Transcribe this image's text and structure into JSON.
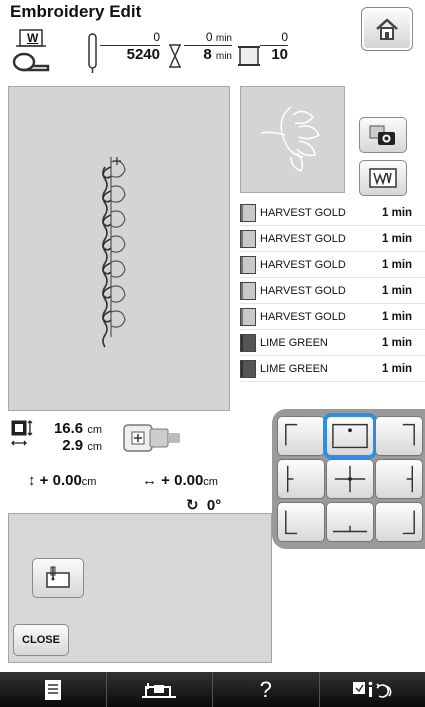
{
  "header": {
    "title": "Embroidery Edit",
    "presser_foot_letter": "W",
    "stitch_count_current": "0",
    "stitch_count_total": "5240",
    "time_current": "0",
    "time_total": "8",
    "time_unit": "min",
    "color_current": "0",
    "color_total": "10"
  },
  "threads": [
    {
      "name": "HARVEST GOLD",
      "time": "1 min",
      "dark": false
    },
    {
      "name": "HARVEST GOLD",
      "time": "1 min",
      "dark": false
    },
    {
      "name": "HARVEST GOLD",
      "time": "1 min",
      "dark": false
    },
    {
      "name": "HARVEST GOLD",
      "time": "1 min",
      "dark": false
    },
    {
      "name": "HARVEST GOLD",
      "time": "1 min",
      "dark": false
    },
    {
      "name": "LIME GREEN",
      "time": "1 min",
      "dark": true
    },
    {
      "name": "LIME GREEN",
      "time": "1 min",
      "dark": true
    }
  ],
  "size": {
    "width_value": "16.6",
    "height_value": "2.9",
    "unit": "cm"
  },
  "offsets": {
    "vertical_value": "+ 0.00",
    "horizontal_value": "+ 0.00",
    "unit": "cm",
    "angle_value": "0°"
  },
  "buttons": {
    "close_label": "CLOSE"
  },
  "toolbar": {
    "help_label": "?"
  },
  "colors": {
    "selection_accent": "#2d8ee6",
    "preview_background": "#d4d4d4"
  }
}
